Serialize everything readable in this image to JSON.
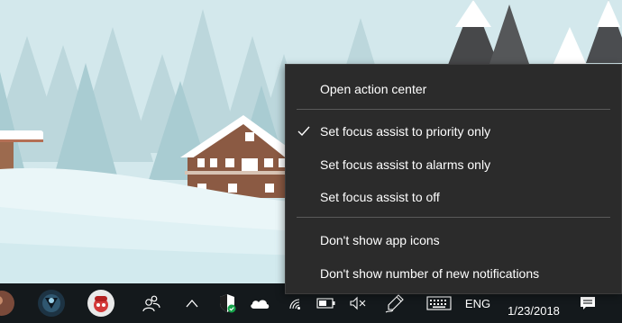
{
  "context_menu": {
    "items": [
      {
        "label": "Open action center",
        "checked": false
      },
      {
        "label": "Set focus assist to priority only",
        "checked": true
      },
      {
        "label": "Set focus assist to alarms only",
        "checked": false
      },
      {
        "label": "Set focus assist to off",
        "checked": false
      },
      {
        "label": "Don't show app icons",
        "checked": false
      },
      {
        "label": "Don't show number of new notifications",
        "checked": false
      }
    ]
  },
  "taskbar": {
    "pinned_icons": [
      "app-icon",
      "dark-game-icon",
      "red-character-icon"
    ],
    "people_icon": "people-icon",
    "tray_icons": [
      "chevron-up-icon",
      "security-shield-icon",
      "onedrive-cloud-icon",
      "wifi-icon",
      "battery-icon",
      "volume-muted-icon",
      "pen-icon",
      "keyboard-icon"
    ],
    "language": "ENG",
    "date": "1/23/2018",
    "notification_icon": "action-center-icon"
  },
  "colors": {
    "menu_bg": "#2b2b2b",
    "taskbar_bg": "#14191c",
    "sky": "#cfe6ea"
  }
}
